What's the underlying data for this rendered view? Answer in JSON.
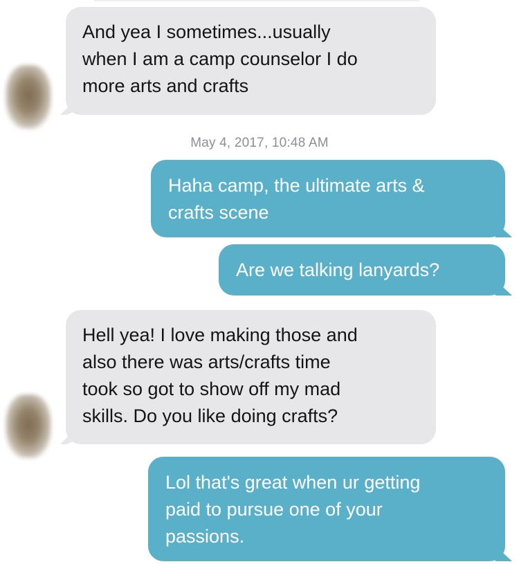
{
  "conversation": {
    "timestamp": "May 4, 2017, 10:48 AM",
    "messages": [
      {
        "direction": "received",
        "text": "And yea I sometimes...usually\nwhen I am a camp counselor I do\nmore arts and crafts"
      },
      {
        "direction": "sent",
        "text": "Haha camp, the ultimate arts &\ncrafts scene"
      },
      {
        "direction": "sent",
        "text": "Are we talking lanyards?"
      },
      {
        "direction": "received",
        "text": "Hell yea! I love making those and\nalso there was arts/crafts time\ntook so got to show off my mad\nskills. Do you like doing crafts?"
      },
      {
        "direction": "sent",
        "text": "Lol that's great when ur getting\npaid to pursue one of your\npassions."
      }
    ]
  },
  "colors": {
    "received_bubble": "#e7e7e9",
    "sent_bubble": "#5ab0c8",
    "timestamp_text": "#8e8e93"
  }
}
